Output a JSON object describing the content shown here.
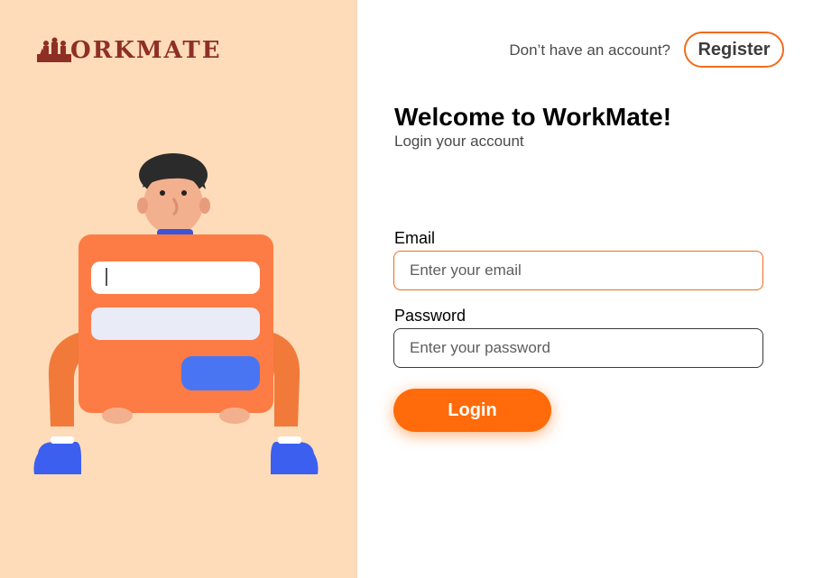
{
  "brand": {
    "name": "ORKMATE",
    "logo_icon": "workmate-logo-icon",
    "color": "#8e2f26"
  },
  "header": {
    "prompt": "Don’t have an account?",
    "register_label": "Register"
  },
  "main": {
    "title": "Welcome to WorkMate!",
    "subtitle": "Login your account"
  },
  "form": {
    "email_label": "Email",
    "email_placeholder": "Enter your email",
    "email_value": "",
    "password_label": "Password",
    "password_placeholder": "Enter your password",
    "password_value": "",
    "login_label": "Login"
  },
  "illustration": {
    "icon": "person-holding-login-card-illustration"
  },
  "colors": {
    "accent": "#ff6b0a",
    "panel_bg": "#fedcb9"
  }
}
